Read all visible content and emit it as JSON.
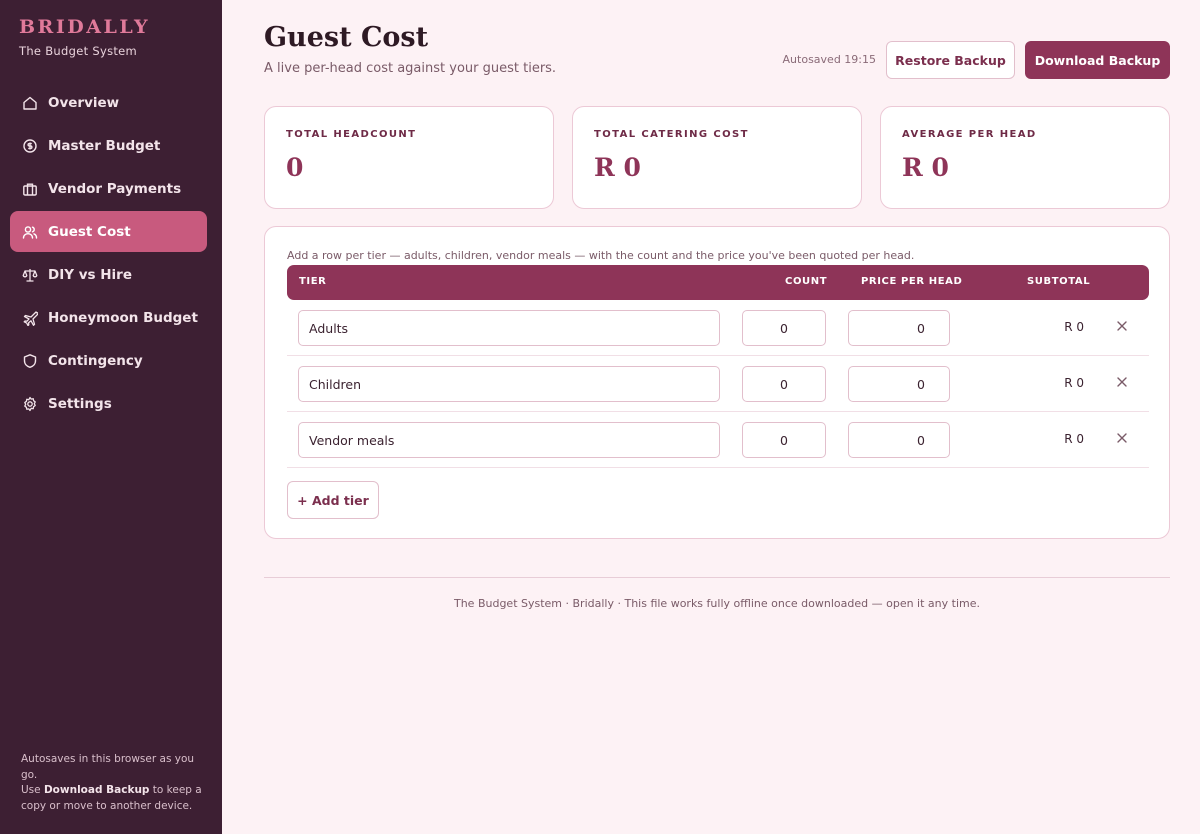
{
  "brand": {
    "name": "BRIDALLY",
    "subtitle": "The Budget System"
  },
  "sidebar": {
    "items": [
      {
        "label": "Overview",
        "icon": "home-icon",
        "active": false
      },
      {
        "label": "Master Budget",
        "icon": "coin-icon",
        "active": false
      },
      {
        "label": "Vendor Payments",
        "icon": "briefcase-icon",
        "active": false
      },
      {
        "label": "Guest Cost",
        "icon": "users-icon",
        "active": true
      },
      {
        "label": "DIY vs Hire",
        "icon": "scale-icon",
        "active": false
      },
      {
        "label": "Honeymoon Budget",
        "icon": "plane-icon",
        "active": false
      },
      {
        "label": "Contingency",
        "icon": "shield-icon",
        "active": false
      },
      {
        "label": "Settings",
        "icon": "gear-icon",
        "active": false
      }
    ],
    "footer": {
      "line1": "Autosaves in this browser as you go.",
      "use": "Use",
      "bold": "Download Backup",
      "rest": "to keep a copy or move to another device."
    }
  },
  "header": {
    "title": "Guest Cost",
    "subtitle": "A live per-head cost against your guest tiers.",
    "autosaved": "Autosaved 19:15",
    "restore_label": "Restore Backup",
    "download_label": "Download Backup"
  },
  "stats": [
    {
      "label": "TOTAL HEADCOUNT",
      "value": "0"
    },
    {
      "label": "TOTAL CATERING COST",
      "value": "R 0"
    },
    {
      "label": "AVERAGE PER HEAD",
      "value": "R 0"
    }
  ],
  "table": {
    "help": "Add a row per tier — adults, children, vendor meals — with the count and the price you've been quoted per head.",
    "headers": {
      "tier": "TIER",
      "count": "COUNT",
      "price": "PRICE PER HEAD",
      "subtotal": "SUBTOTAL"
    },
    "rows": [
      {
        "tier": "Adults",
        "count": "0",
        "price": "0",
        "subtotal": "R 0"
      },
      {
        "tier": "Children",
        "count": "0",
        "price": "0",
        "subtotal": "R 0"
      },
      {
        "tier": "Vendor meals",
        "count": "0",
        "price": "0",
        "subtotal": "R 0"
      }
    ],
    "add_label": "+ Add tier"
  },
  "footer": "The Budget System · Bridally · This file works fully offline once downloaded — open it any time.",
  "colors": {
    "sidebar": "#3d1f33",
    "accent": "#8e3458",
    "active_nav": "#c85a7e",
    "background": "#fdf2f5"
  }
}
